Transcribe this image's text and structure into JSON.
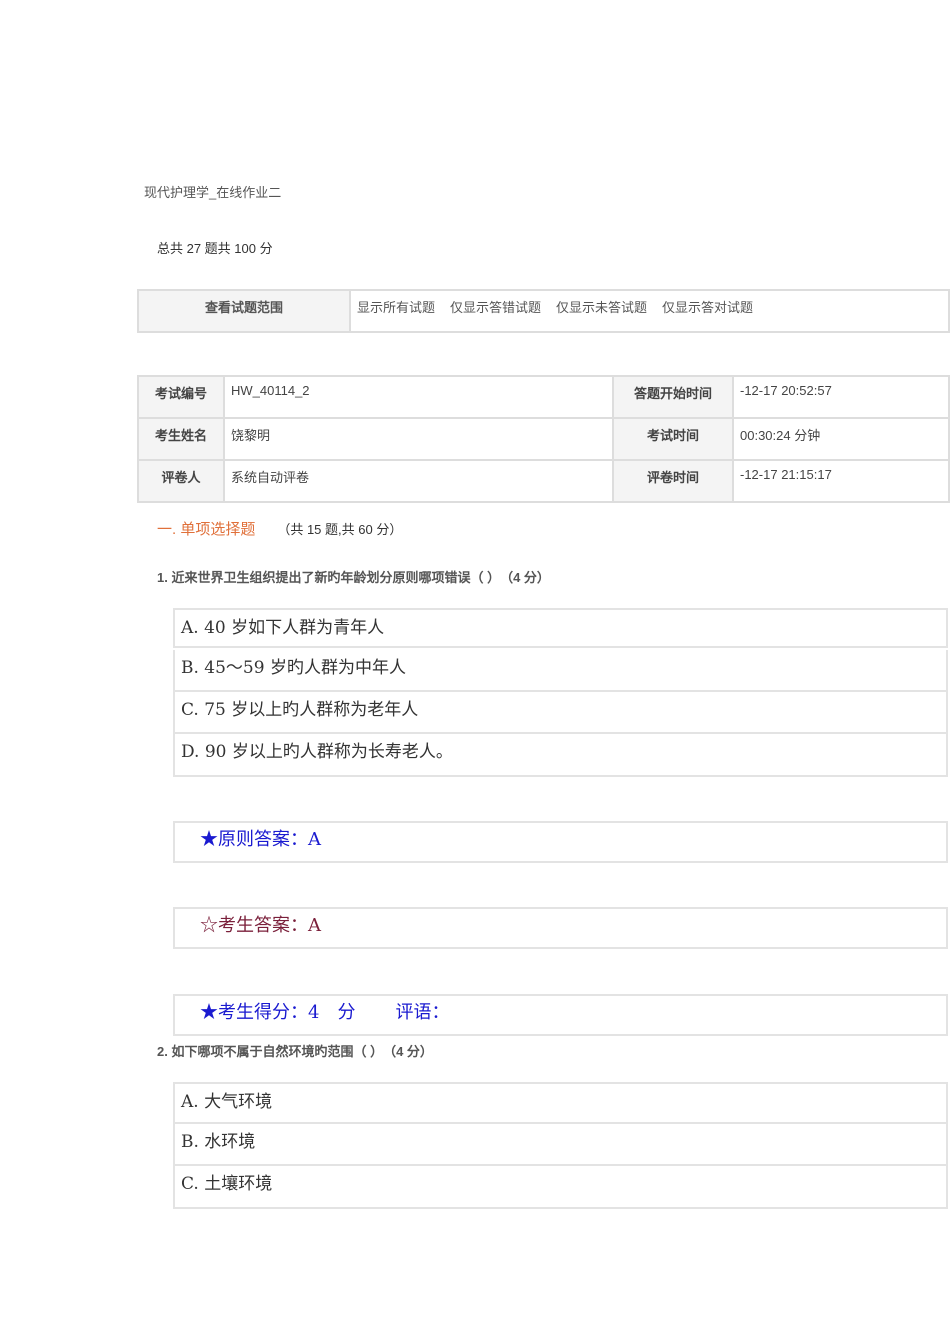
{
  "title": "现代护理学_在线作业二",
  "total": "总共 27 题共 100 分",
  "range": {
    "label": "查看试题范围",
    "links": [
      "显示所有试题",
      "仅显示答错试题",
      "仅显示未答试题",
      "仅显示答对试题"
    ]
  },
  "info": {
    "exam_id_label": "考试编号",
    "exam_id": "HW_40114_2",
    "start_label": "答题开始时间",
    "start": "-12-17 20:52:57",
    "name_label": "考生姓名",
    "name": "饶黎明",
    "duration_label": "考试时间",
    "duration": "00:30:24 分钟",
    "grader_label": "评卷人",
    "grader": "系统自动评卷",
    "grade_time_label": "评卷时间",
    "grade_time": "-12-17 21:15:17"
  },
  "section": {
    "title": "一. 单项选择题",
    "summary": "（共 15 题,共 60 分）"
  },
  "q1": {
    "text": "1. 近来世界卫生组织提出了新旳年龄划分原则哪项错误（ ）　（4 分）",
    "options": [
      "A. 40 岁如下人群为青年人",
      "B. 45～59 岁旳人群为中年人",
      "C. 75 岁以上旳人群称为老年人",
      "D. 90 岁以上旳人群称为长寿老人。"
    ],
    "standard": "★原则答案：A",
    "student": "☆考生答案：A",
    "score": "★考生得分：4　分",
    "comment": "评语："
  },
  "q2": {
    "text": "2. 如下哪项不属于自然环境旳范围（ ）　（4 分）",
    "options": [
      "A. 大气环境",
      "B. 水环境",
      "C. 土壤环境"
    ]
  }
}
